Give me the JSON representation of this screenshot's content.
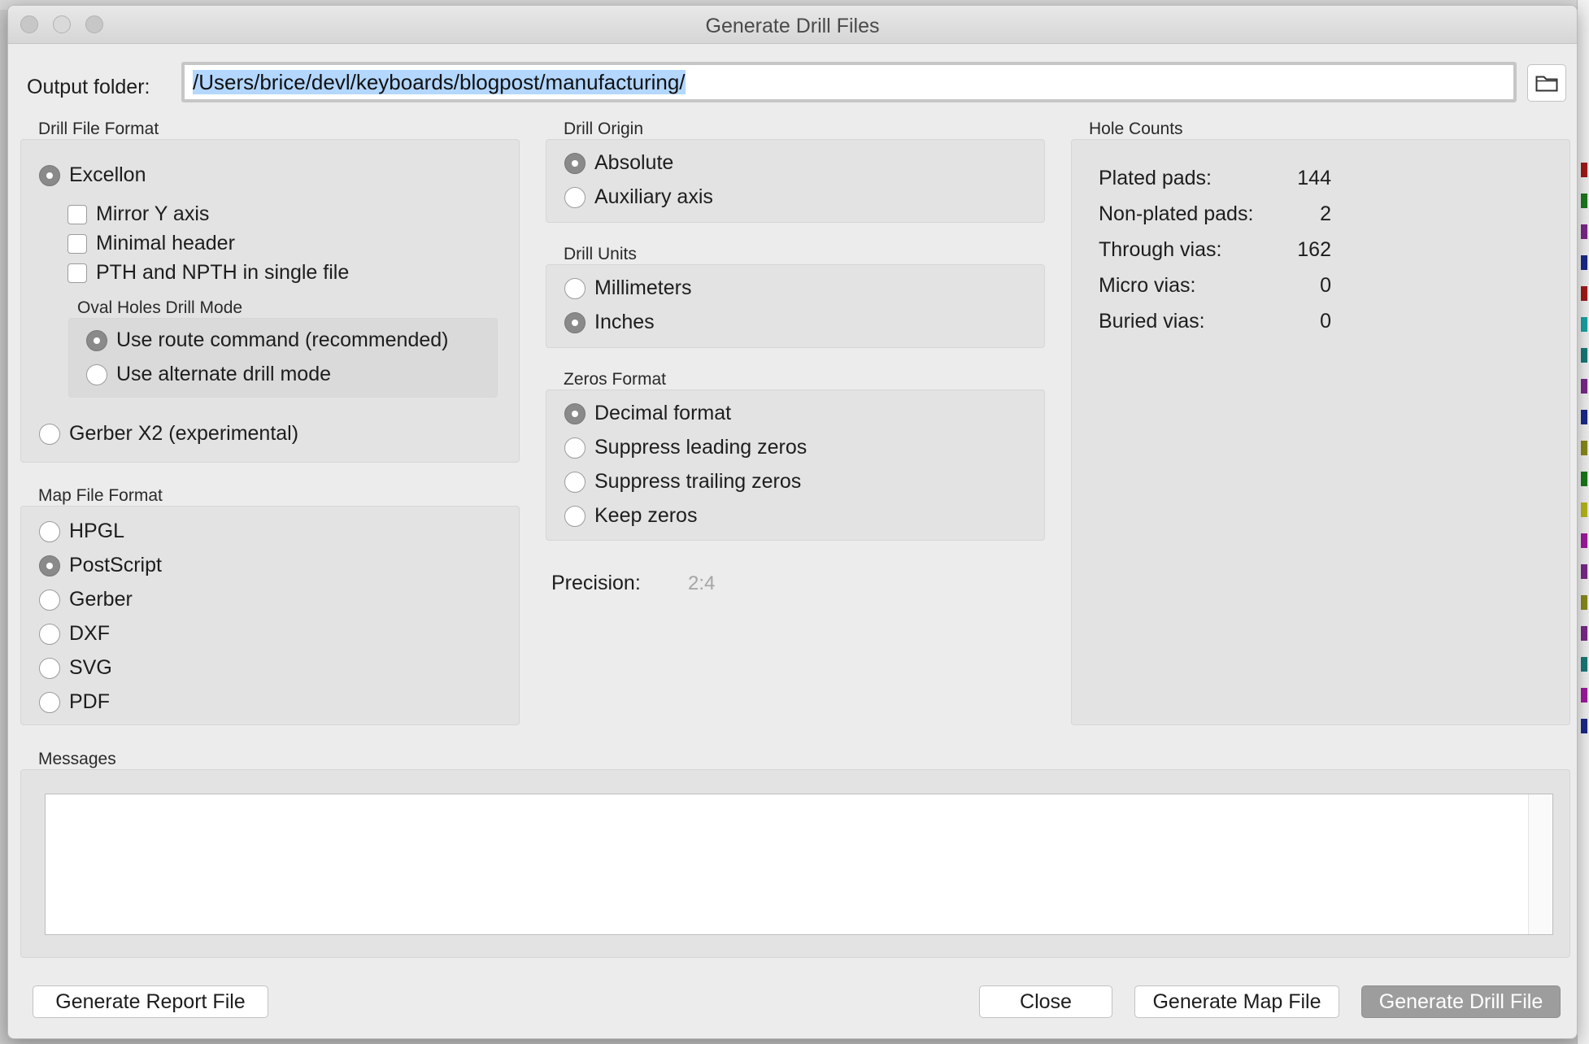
{
  "window": {
    "title": "Generate Drill Files"
  },
  "output": {
    "label": "Output folder:",
    "path": "/Users/brice/devl/keyboards/blogpost/manufacturing/"
  },
  "drill_format": {
    "title": "Drill File Format",
    "excellon": "Excellon",
    "mirror_y": "Mirror Y axis",
    "minimal_header": "Minimal header",
    "pth_npth": "PTH and NPTH in single file",
    "oval_title": "Oval Holes Drill Mode",
    "oval_route": "Use route command (recommended)",
    "oval_alt": "Use alternate drill mode",
    "gerber_x2": "Gerber X2 (experimental)"
  },
  "map_format": {
    "title": "Map File Format",
    "options": [
      "HPGL",
      "PostScript",
      "Gerber",
      "DXF",
      "SVG",
      "PDF"
    ],
    "selected": "PostScript"
  },
  "drill_origin": {
    "title": "Drill Origin",
    "absolute": "Absolute",
    "aux": "Auxiliary axis",
    "selected": "Absolute"
  },
  "drill_units": {
    "title": "Drill Units",
    "mm": "Millimeters",
    "inches": "Inches",
    "selected": "Inches"
  },
  "zeros_format": {
    "title": "Zeros Format",
    "decimal": "Decimal format",
    "leading": "Suppress leading zeros",
    "trailing": "Suppress trailing zeros",
    "keep": "Keep zeros",
    "selected": "Decimal format"
  },
  "precision": {
    "label": "Precision:",
    "value": "2:4"
  },
  "hole_counts": {
    "title": "Hole Counts",
    "rows": [
      {
        "label": "Plated pads:",
        "value": "144"
      },
      {
        "label": "Non-plated pads:",
        "value": "2"
      },
      {
        "label": "Through vias:",
        "value": "162"
      },
      {
        "label": "Micro vias:",
        "value": "0"
      },
      {
        "label": "Buried vias:",
        "value": "0"
      }
    ]
  },
  "messages": {
    "title": "Messages"
  },
  "buttons": {
    "report": "Generate Report File",
    "close": "Close",
    "map": "Generate Map File",
    "drill": "Generate Drill File"
  },
  "icons": {
    "folder": "folder-icon"
  },
  "colors": {
    "selection": "#b3d7ff",
    "primary_button": "#9d9d9d",
    "radio_selected": "#8a8a8a"
  }
}
